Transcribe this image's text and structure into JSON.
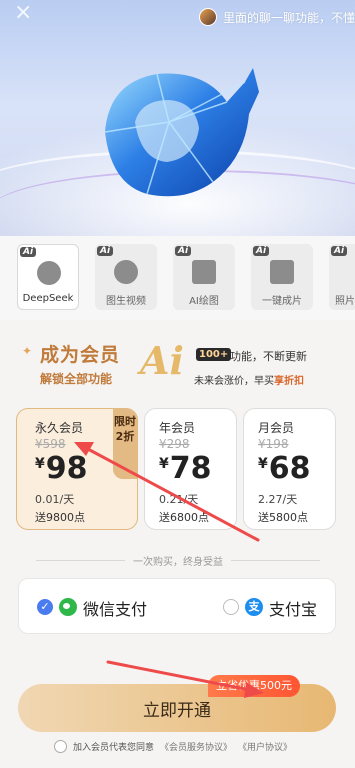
{
  "header": {
    "close_icon": "close-icon",
    "ticker_text": "里面的聊一聊功能，不懂"
  },
  "tools": [
    {
      "label": "DeepSeek",
      "icon": "deepseek-icon",
      "tag": "Ai"
    },
    {
      "label": "图生视频",
      "icon": "play-icon",
      "tag": "Ai"
    },
    {
      "label": "AI绘图",
      "icon": "image-icon",
      "tag": "Ai"
    },
    {
      "label": "一键成片",
      "icon": "video-icon",
      "tag": "Ai"
    },
    {
      "label": "照片",
      "icon": "photo-person-icon",
      "tag": "Ai"
    }
  ],
  "promo": {
    "title": "成为会员",
    "subtitle": "解锁全部功能",
    "big_text": "Ai",
    "badge": "100+",
    "line1": "功能，不断更新",
    "line2_prefix": "未来会涨价，早买",
    "line2_emph": "享折扣"
  },
  "plans": [
    {
      "name": "永久会员",
      "original": "¥598",
      "currency": "¥",
      "price": "98",
      "daily": "0.01/天",
      "bonus": "送9800点",
      "tag": "限时2折",
      "selected": true
    },
    {
      "name": "年会员",
      "original": "¥298",
      "currency": "¥",
      "price": "78",
      "daily": "0.21/天",
      "bonus": "送6800点",
      "selected": false
    },
    {
      "name": "月会员",
      "original": "¥198",
      "currency": "¥",
      "price": "68",
      "daily": "2.27/天",
      "bonus": "送5800点",
      "selected": false
    }
  ],
  "divider_text": "一次购买，终身受益",
  "payment": {
    "wechat": "微信支付",
    "alipay": "支付宝",
    "alipay_glyph": "支",
    "selected": "wechat"
  },
  "cta": {
    "label": "立即开通",
    "save_badge": "立省优惠500元"
  },
  "agreement": {
    "text": "加入会员代表您同意",
    "link1": "《会员服务协议》",
    "link2": "《用户协议》"
  },
  "colors": {
    "accent_gold": "#e7b873",
    "selected_bg": "#fbeedd",
    "arrow_red": "#ee4a4a"
  }
}
